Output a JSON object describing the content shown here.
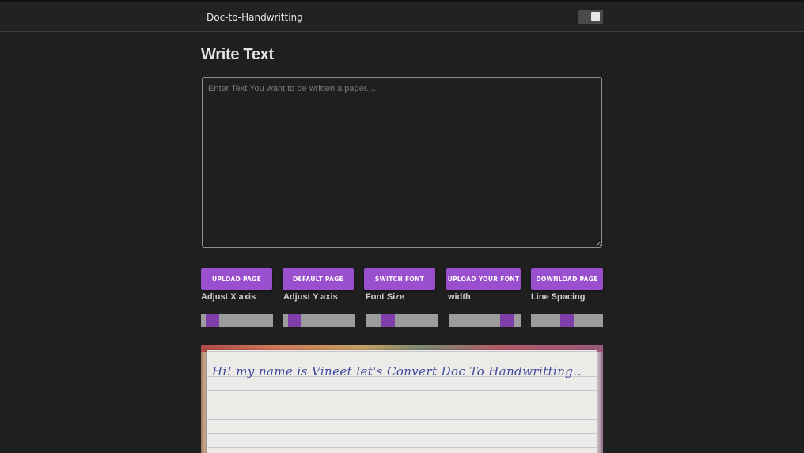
{
  "app": {
    "title": "Doc-to-Handwritting"
  },
  "main": {
    "heading": "Write Text",
    "editor_placeholder": "Enter Text You want to be written a paper....",
    "editor_value": ""
  },
  "buttons": [
    {
      "label": "UPLOAD PAGE"
    },
    {
      "label": "DEFAULT PAGE"
    },
    {
      "label": "SWITCH FONT"
    },
    {
      "label": "UPLOAD YOUR FONT"
    },
    {
      "label": "DOWNLOAD PAGE"
    }
  ],
  "controls": [
    {
      "label": "Adjust X axis",
      "value_fraction": 0.08
    },
    {
      "label": "Adjust Y axis",
      "value_fraction": 0.08
    },
    {
      "label": "Font Size",
      "value_fraction": 0.27
    },
    {
      "label": "width",
      "value_fraction": 0.88
    },
    {
      "label": "Line Spacing",
      "value_fraction": 0.5
    }
  ],
  "preview": {
    "handwritten_text": "Hi! my name is Vineet let's Convert Doc To Handwritting.."
  },
  "colors": {
    "accent": "#9a4fcf",
    "slider_thumb": "#7e3fa8",
    "slider_track": "#9c9c9c",
    "background": "#1f1f1f",
    "ink": "#3f4aa0"
  },
  "icons": {
    "theme_toggle": "toggle-switch-icon"
  }
}
